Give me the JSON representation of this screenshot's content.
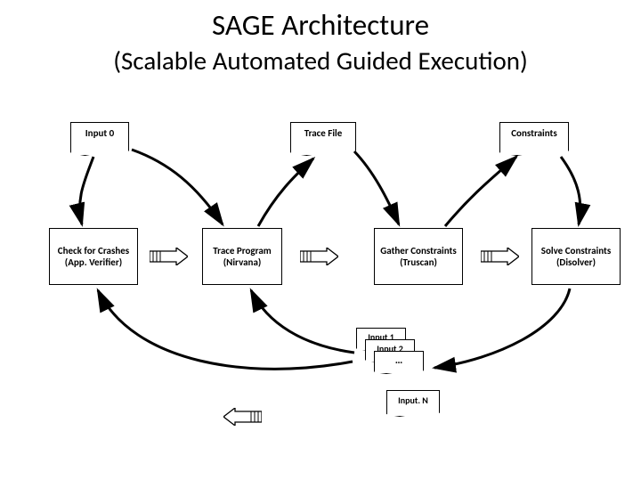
{
  "title": "SAGE Architecture",
  "subtitle": "(Scalable Automated Guided Execution)",
  "docs": {
    "input0": "Input 0",
    "traceFile": "Trace File",
    "constraints": "Constraints",
    "input1": "Input 1",
    "input2": "Input 2",
    "inputDots": "…",
    "inputN": "Input. N"
  },
  "procs": {
    "check": "Check for Crashes (App. Verifier)",
    "trace": "Trace Program (Nirvana)",
    "gather": "Gather Constraints (Truscan)",
    "solve": "Solve Constraints (Disolver)"
  }
}
